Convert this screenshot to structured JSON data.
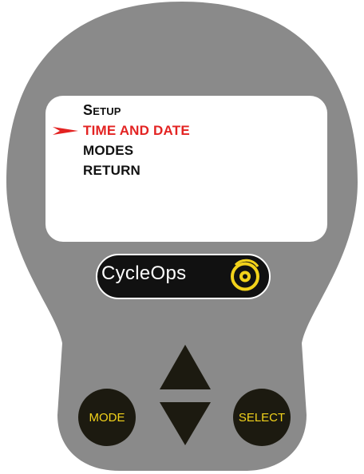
{
  "device": {
    "brand": "CycleOps",
    "colors": {
      "body": "#8a8a8a",
      "screen": "#ffffff",
      "menu_text": "#111111",
      "selected_text": "#e32322",
      "button_fill": "#1c1a10",
      "button_text": "#f2d21b",
      "logo_ring": "#f2d21b"
    }
  },
  "screen": {
    "menu": {
      "title": "Setup",
      "items": [
        "TIME AND DATE",
        "MODES",
        "RETURN"
      ],
      "selected_index": 0
    },
    "pointer_icon": "right-arrow-pointer-icon"
  },
  "buttons": {
    "mode_label": "MODE",
    "select_label": "SELECT",
    "up_icon": "up-triangle-icon",
    "down_icon": "down-triangle-icon"
  }
}
